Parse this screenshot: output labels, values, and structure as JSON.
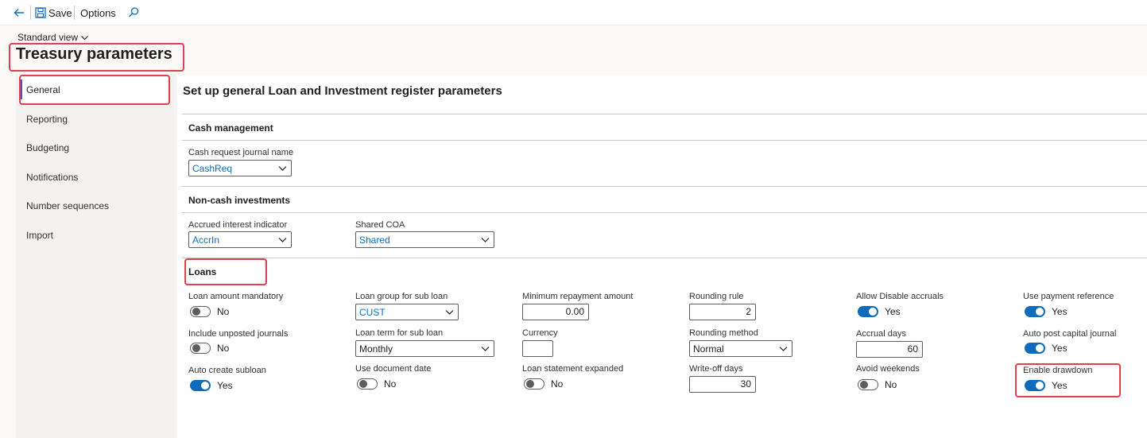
{
  "toolbar": {
    "save_label": "Save",
    "options_label": "Options"
  },
  "header": {
    "view_label": "Standard view",
    "page_title": "Treasury parameters"
  },
  "nav": {
    "items": [
      "General",
      "Reporting",
      "Budgeting",
      "Notifications",
      "Number sequences",
      "Import"
    ]
  },
  "content": {
    "title": "Set up general Loan and Investment register parameters"
  },
  "cash_management": {
    "title": "Cash management",
    "journal_label": "Cash request journal name",
    "journal_value": "CashReq"
  },
  "noncash": {
    "title": "Non-cash investments",
    "accrued_label": "Accrued interest indicator",
    "accrued_value": "AccrIn",
    "coa_label": "Shared COA",
    "coa_value": "Shared"
  },
  "loans": {
    "title": "Loans",
    "loan_amount_mandatory": {
      "label": "Loan amount mandatory",
      "value": "No",
      "on": false
    },
    "include_unposted": {
      "label": "Include unposted journals",
      "value": "No",
      "on": false
    },
    "auto_create_subloan": {
      "label": "Auto create subloan",
      "value": "Yes",
      "on": true
    },
    "loan_group": {
      "label": "Loan group for sub loan",
      "value": "CUST"
    },
    "loan_term": {
      "label": "Loan term for sub loan",
      "value": "Monthly"
    },
    "use_document_date": {
      "label": "Use document date",
      "value": "No",
      "on": false
    },
    "min_repayment": {
      "label": "Minimum repayment amount",
      "value": "0.00"
    },
    "currency": {
      "label": "Currency",
      "value": ""
    },
    "statement_expanded": {
      "label": "Loan statement expanded",
      "value": "No",
      "on": false
    },
    "rounding_rule": {
      "label": "Rounding rule",
      "value": "2"
    },
    "rounding_method": {
      "label": "Rounding method",
      "value": "Normal"
    },
    "writeoff_days": {
      "label": "Write-off days",
      "value": "30"
    },
    "allow_disable_accruals": {
      "label": "Allow Disable accruals",
      "value": "Yes",
      "on": true
    },
    "accrual_days": {
      "label": "Accrual days",
      "value": "60"
    },
    "avoid_weekends": {
      "label": "Avoid weekends",
      "value": "No",
      "on": false
    },
    "use_payment_reference": {
      "label": "Use payment reference",
      "value": "Yes",
      "on": true
    },
    "auto_post_capital": {
      "label": "Auto post capital journal",
      "value": "Yes",
      "on": true
    },
    "enable_drawdown": {
      "label": "Enable drawdown",
      "value": "Yes",
      "on": true
    }
  },
  "colors": {
    "accent": "#0f6cbd",
    "highlight": "#e0404f",
    "nav_indicator": "#4f52b2"
  },
  "icons": [
    "back-arrow-icon",
    "save-icon",
    "search-icon",
    "chevron-down-icon"
  ]
}
